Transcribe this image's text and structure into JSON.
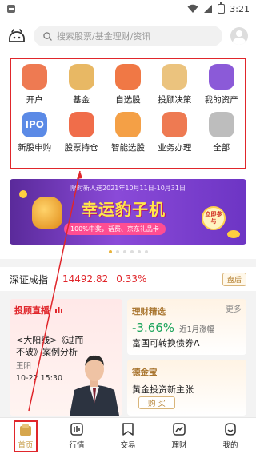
{
  "status_bar": {
    "time": "3:21"
  },
  "header": {
    "search_placeholder": "搜索股票/基金理财/资讯"
  },
  "grid": {
    "items": [
      {
        "label": "开户",
        "icon": "person-icon",
        "color": "#ee7a52",
        "glyph": ""
      },
      {
        "label": "基金",
        "icon": "chart-card-icon",
        "color": "#e8b864",
        "glyph": ""
      },
      {
        "label": "自选股",
        "icon": "stack-icon",
        "color": "#f07845",
        "glyph": ""
      },
      {
        "label": "投顾决策",
        "icon": "envelope-icon",
        "color": "#ebc37e",
        "glyph": ""
      },
      {
        "label": "我的资产",
        "icon": "wallet-icon",
        "color": "#8b5ad8",
        "glyph": ""
      },
      {
        "label": "新股申购",
        "icon": "ipo-icon",
        "color": "#5b8ae6",
        "glyph": "IPO"
      },
      {
        "label": "股票持仓",
        "icon": "bars-icon",
        "color": "#f06d4a",
        "glyph": ""
      },
      {
        "label": "智能选股",
        "icon": "ring-icon",
        "color": "#f4a046",
        "glyph": ""
      },
      {
        "label": "业务办理",
        "icon": "task-icon",
        "color": "#ee7a52",
        "glyph": ""
      },
      {
        "label": "全部",
        "icon": "apps-icon",
        "color": "#bdbdbd",
        "glyph": ""
      }
    ]
  },
  "banner": {
    "top_text": "限时新人送2021年10月11日-10月31日",
    "title": "幸运豹子机",
    "subtitle": "100%中奖，话费、京东礼品卡",
    "button": "立即参与",
    "dots_total": 6,
    "dots_active": 0
  },
  "index": {
    "name": "深证成指",
    "value": "14492.82",
    "pct": "0.33%",
    "tag": "盘后"
  },
  "cards": {
    "left": {
      "tag": "投顾直播",
      "text": "<大阳线>《过而不破》案例分析",
      "author": "王阳",
      "time": "10-22 15:30"
    },
    "right_top": {
      "tag": "理财精选",
      "more": "更多",
      "pct": "-3.66%",
      "pct_note": "近1月涨幅",
      "title": "富国可转换债券A"
    },
    "right_bottom": {
      "tag": "德金宝",
      "title": "黄金投资新主张",
      "button": "购 买"
    }
  },
  "bottom_nav": {
    "items": [
      {
        "label": "首页",
        "icon": "home-icon"
      },
      {
        "label": "行情",
        "icon": "market-icon"
      },
      {
        "label": "交易",
        "icon": "trade-icon"
      },
      {
        "label": "理财",
        "icon": "finance-icon"
      },
      {
        "label": "我的",
        "icon": "profile-icon"
      }
    ]
  }
}
